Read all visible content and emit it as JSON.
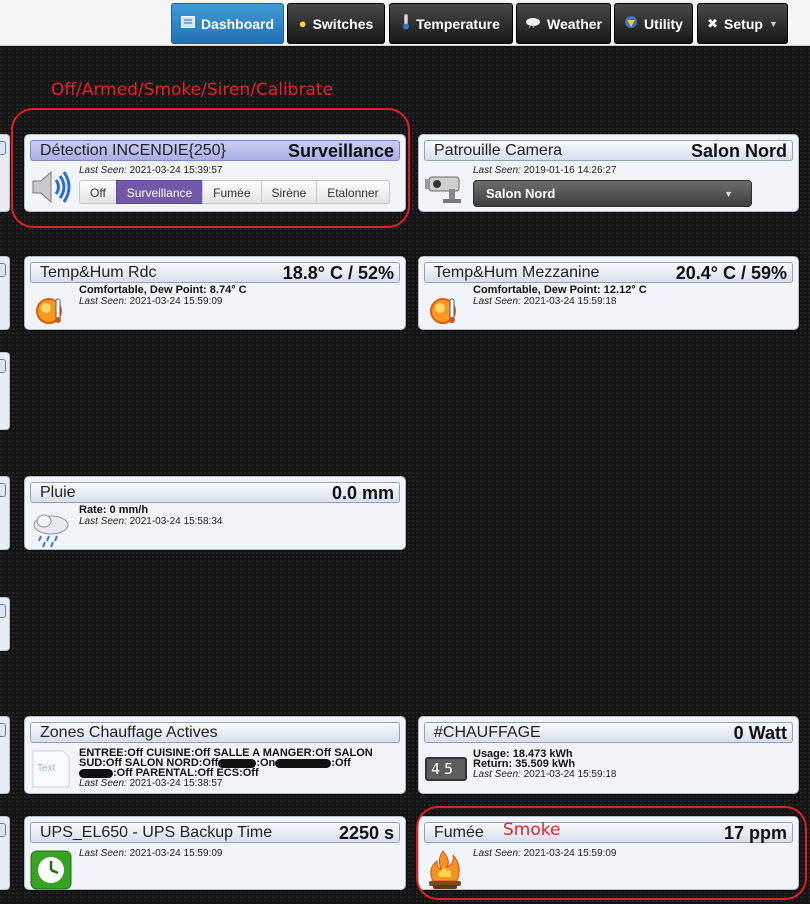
{
  "nav": {
    "dashboard": "Dashboard",
    "switches": "Switches",
    "temperature": "Temperature",
    "weather": "Weather",
    "utility": "Utility",
    "setup": "Setup"
  },
  "annotations": {
    "modes_caption": "Off/Armed/Smoke/Siren/Calibrate",
    "smoke_caption": "Smoke"
  },
  "widgets": {
    "detection": {
      "name": "Détection INCENDIE{250}",
      "value": "Surveillance",
      "last_seen_label": "Last Seen:",
      "last_seen": "2021-03-24 15:39:57",
      "levels": [
        "Off",
        "Surveillance",
        "Fumée",
        "Sirène",
        "Etalonner"
      ],
      "selected": "Surveillance",
      "header_color": "#b3b8ec",
      "selected_color": "#7258a8"
    },
    "camera": {
      "name": "Patrouille Camera",
      "value": "Salon Nord",
      "last_seen_label": "Last Seen:",
      "last_seen": "2019-01-16 14:26:27",
      "dropdown_selected": "Salon Nord"
    },
    "temp_rdc": {
      "name": "Temp&Hum Rdc",
      "value": "18.8° C / 52%",
      "status": "Comfortable, Dew Point: 8.74° C",
      "last_seen_label": "Last Seen:",
      "last_seen": "2021-03-24 15:59:09"
    },
    "temp_mezz": {
      "name": "Temp&Hum Mezzanine",
      "value": "20.4° C / 59%",
      "status": "Comfortable, Dew Point: 12.12° C",
      "last_seen_label": "Last Seen:",
      "last_seen": "2021-03-24 15:59:18"
    },
    "pluie": {
      "name": "Pluie",
      "value": "0.0 mm",
      "rate": "Rate: 0 mm/h",
      "last_seen_label": "Last Seen:",
      "last_seen": "2021-03-24 15:58:34"
    },
    "zones": {
      "name": "Zones Chauffage Actives",
      "icon_text": "Text",
      "line1": "ENTREE:Off CUISINE:Off SALLE A MANGER:Off SALON",
      "line2a": "SUD:Off SALON NORD:Off",
      "line2b": ":On",
      "line2c": ":Off",
      "line3": ":Off PARENTAL:Off ECS:Off",
      "last_seen_label": "Last Seen:",
      "last_seen": "2021-03-24 15:38:57"
    },
    "chauffage": {
      "name": "#CHAUFFAGE",
      "value": "0 Watt",
      "meter_digits": "45",
      "usage": "Usage: 18.473 kWh",
      "return": "Return: 35.509 kWh",
      "last_seen_label": "Last Seen:",
      "last_seen": "2021-03-24 15:59:18"
    },
    "ups": {
      "name": "UPS_EL650 - UPS Backup Time",
      "value": "2250 s",
      "last_seen_label": "Last Seen:",
      "last_seen": "2021-03-24 15:59:09"
    },
    "fumee": {
      "name": "Fumée",
      "value": "17 ppm",
      "last_seen_label": "Last Seen:",
      "last_seen": "2021-03-24 15:59:09"
    }
  }
}
